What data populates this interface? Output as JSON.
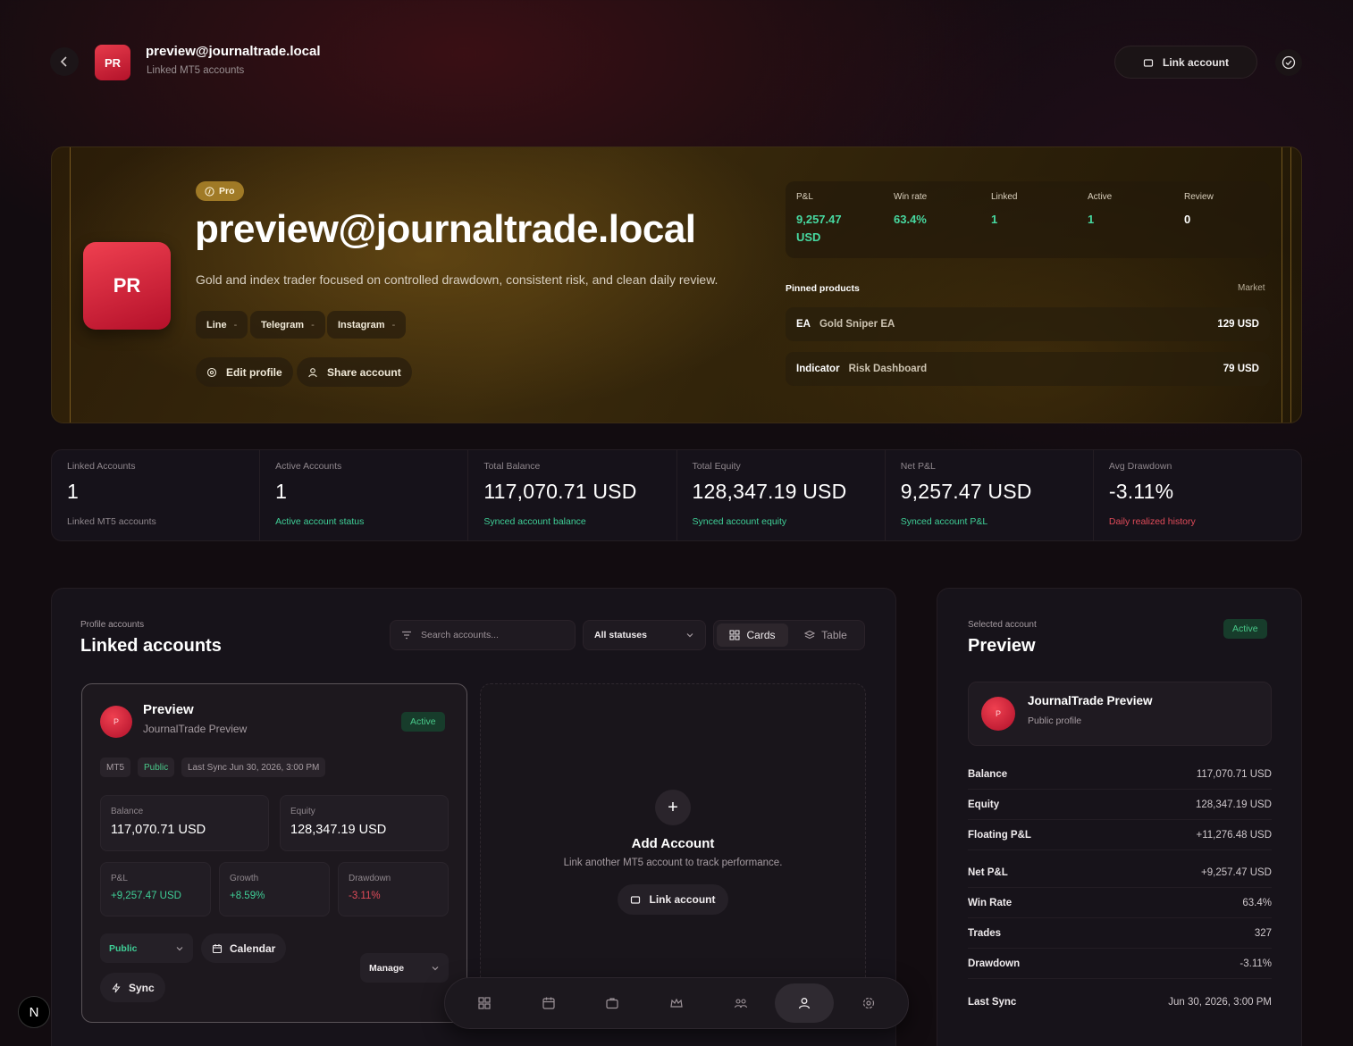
{
  "header": {
    "title": "preview@journaltrade.local",
    "subtitle": "Linked MT5 accounts",
    "avatar": "PR",
    "link_account": "Link account"
  },
  "hero": {
    "badge": "Pro",
    "title": "preview@journaltrade.local",
    "bio": "Gold and index trader focused on controlled drawdown, consistent risk, and clean daily review.",
    "avatar": "PR",
    "socials": [
      {
        "label": "Line",
        "value": "-"
      },
      {
        "label": "Telegram",
        "value": "-"
      },
      {
        "label": "Instagram",
        "value": "-"
      }
    ],
    "edit_profile": "Edit profile",
    "share_account": "Share account",
    "stats": [
      {
        "label": "P&L",
        "value": "9,257.47 USD"
      },
      {
        "label": "Win rate",
        "value": "63.4%"
      },
      {
        "label": "Linked",
        "value": "1"
      },
      {
        "label": "Active",
        "value": "1"
      },
      {
        "label": "Review",
        "value": "0"
      }
    ],
    "pinned_title": "Pinned products",
    "market_label": "Market",
    "products": [
      {
        "type": "EA",
        "name": "Gold Sniper EA",
        "price": "129 USD"
      },
      {
        "type": "Indicator",
        "name": "Risk Dashboard",
        "price": "79 USD"
      }
    ]
  },
  "metrics": [
    {
      "label": "Linked Accounts",
      "value": "1",
      "sub": "Linked MT5 accounts"
    },
    {
      "label": "Active Accounts",
      "value": "1",
      "sub": "Active account status"
    },
    {
      "label": "Total Balance",
      "value": "117,070.71 USD",
      "sub": "Synced account balance"
    },
    {
      "label": "Total Equity",
      "value": "128,347.19 USD",
      "sub": "Synced account equity"
    },
    {
      "label": "Net P&L",
      "value": "9,257.47 USD",
      "sub": "Synced account P&L"
    },
    {
      "label": "Avg Drawdown",
      "value": "-3.11%",
      "sub": "Daily realized history"
    }
  ],
  "accounts_panel": {
    "eyebrow": "Profile accounts",
    "title": "Linked accounts",
    "search_placeholder": "Search accounts...",
    "status_filter": "All statuses",
    "view_cards": "Cards",
    "view_table": "Table"
  },
  "account_card": {
    "avatar": "P",
    "name": "Preview",
    "subtitle": "JournalTrade Preview",
    "status": "Active",
    "tags": [
      "MT5",
      "Public",
      "Last Sync Jun 30, 2026, 3:00 PM"
    ],
    "balance_label": "Balance",
    "balance": "117,070.71 USD",
    "equity_label": "Equity",
    "equity": "128,347.19 USD",
    "pnl_label": "P&L",
    "pnl": "+9,257.47 USD",
    "growth_label": "Growth",
    "growth": "+8.59%",
    "drawdown_label": "Drawdown",
    "drawdown": "-3.11%",
    "visibility": "Public",
    "calendar": "Calendar",
    "manage": "Manage",
    "sync": "Sync"
  },
  "add_card": {
    "title": "Add Account",
    "subtitle": "Link another MT5 account to track performance.",
    "button": "Link account"
  },
  "selected": {
    "eyebrow": "Selected account",
    "title": "Preview",
    "status": "Active",
    "profile_avatar": "P",
    "profile_name": "JournalTrade Preview",
    "profile_sub": "Public profile",
    "rows": [
      {
        "k": "Balance",
        "v": "117,070.71 USD"
      },
      {
        "k": "Equity",
        "v": "128,347.19 USD"
      },
      {
        "k": "Floating P&L",
        "v": "+11,276.48 USD"
      },
      {
        "k": "Net P&L",
        "v": "+9,257.47 USD"
      },
      {
        "k": "Win Rate",
        "v": "63.4%"
      },
      {
        "k": "Trades",
        "v": "327"
      },
      {
        "k": "Drawdown",
        "v": "-3.11%"
      },
      {
        "k": "Last Sync",
        "v": "Jun 30, 2026, 3:00 PM"
      }
    ]
  },
  "dock": [
    "dashboard-icon",
    "calendar-icon",
    "briefcase-icon",
    "crown-icon",
    "community-icon",
    "profile-icon",
    "settings-icon"
  ],
  "next_badge": "N"
}
